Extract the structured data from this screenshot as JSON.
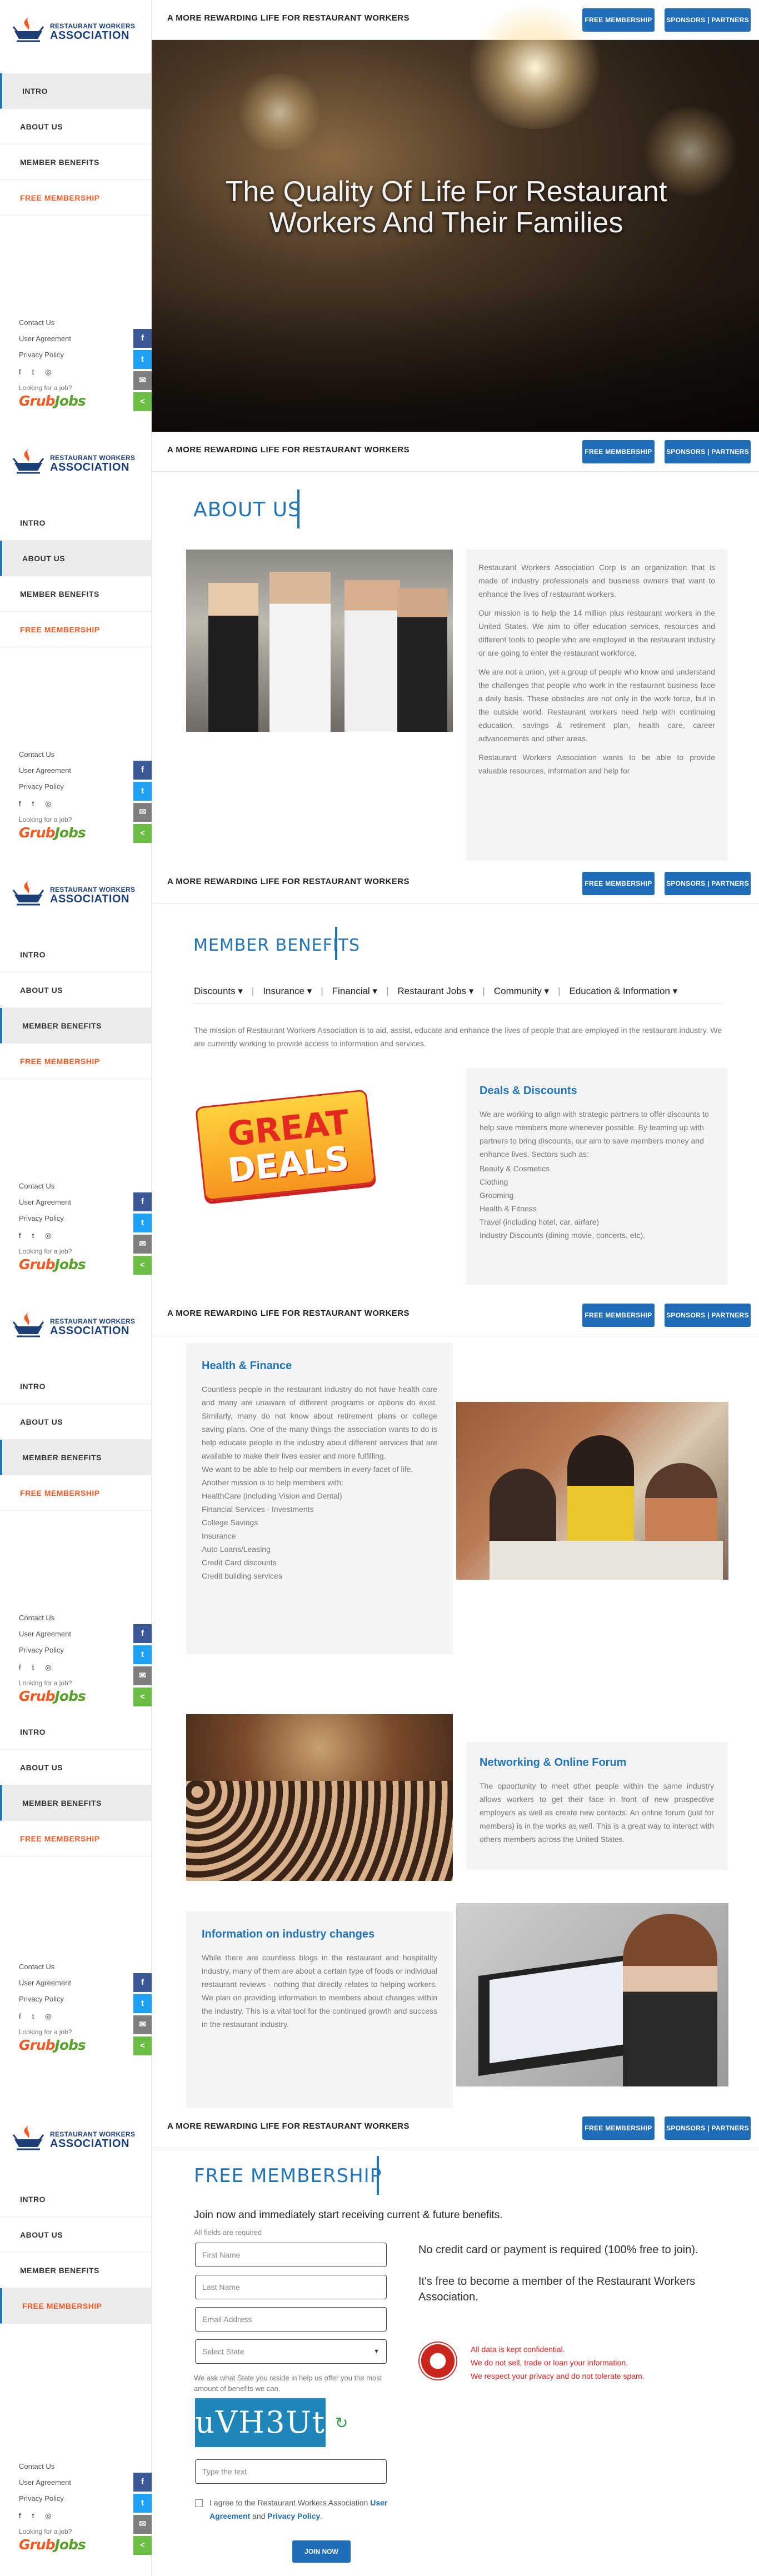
{
  "brand": {
    "line1": "RESTAURANT WORKERS",
    "line2": "ASSOCIATION"
  },
  "nav": [
    "INTRO",
    "ABOUT US",
    "MEMBER BENEFITS",
    "FREE MEMBERSHIP"
  ],
  "sidebar_footer": {
    "links": [
      "Contact Us",
      "User Agreement",
      "Privacy Policy"
    ],
    "looking": "Looking for a job?",
    "grub_a": "Grub",
    "grub_b": "Jobs"
  },
  "share_icons": [
    "f",
    "t",
    "✉",
    "<"
  ],
  "topbar": {
    "tagline": "A MORE REWARDING LIFE FOR RESTAURANT WORKERS",
    "btn_membership": "FREE MEMBERSHIP",
    "btn_sponsors": "SPONSORS | PARTNERS"
  },
  "intro": {
    "headline_1": "The Quality Of Life For Restaurant",
    "headline_2": "Workers And Their Families"
  },
  "about": {
    "title": "ABOUT US",
    "paras": [
      "Restaurant Workers Association Corp is an organization that is made of industry professionals and business owners that want to enhance the lives of restaurant workers.",
      "Our mission is to help the 14 million plus restaurant workers in the United States. We aim to offer education services, resources and different tools to people who are employed in the restaurant industry or are going to enter the restaurant workforce.",
      "We are not a union, yet a group of people who know and understand the challenges that people who work in the restaurant business face a daily basis. These obstacles are not only in the work force, but in the outside world. Restaurant workers need help with continuing education, savings & retirement plan, health care, career advancements and other areas.",
      "Restaurant Workers Association wants to be able to provide valuable resources, information and help for"
    ]
  },
  "benefits": {
    "title": "MEMBER BENEFITS",
    "subnav": [
      "Discounts ▾",
      "Insurance ▾",
      "Financial ▾",
      "Restaurant Jobs ▾",
      "Community ▾",
      "Education & Information ▾"
    ],
    "mission": "The mission of Restaurant Workers Association is to aid, assist, educate and enhance the lives of people that are employed in the restaurant industry. We are currently working to provide access to information and services.",
    "deals_img_1": "GREAT",
    "deals_img_2": "DEALS",
    "deals_title": "Deals & Discounts",
    "deals_text": "We are working to align with strategic partners to offer discounts to help save members more whenever possible. By teaming up with partners to bring discounts, our aim to save members money and enhance lives. Sectors such as:",
    "deals_list": [
      "Beauty & Cosmetics",
      "Clothing",
      "Grooming",
      "Health & Fitness",
      "Travel (including hotel, car, airfare)",
      "Industry Discounts (dining movie, concerts, etc)."
    ]
  },
  "health": {
    "title": "Health & Finance",
    "text": "Countless people in the restaurant industry do not have health care and many are unaware of different programs or options do exist. Similarly, many do not know about retirement plans or college saving plans. One of the many things the association wants to do is help educate people in the industry about different services that are available to make their lives easier and more fulfilling.",
    "text2": "We want to be able to help our members in every facet of life. Another mission is to help members with:",
    "list": [
      "HealthCare (including Vision and Dental)",
      "Financial Services - Investments",
      "College Savings",
      "Insurance",
      "Auto Loans/Leasing",
      "Credit Card discounts",
      "Credit building services"
    ]
  },
  "network": {
    "title": "Networking & Online Forum",
    "text": "The opportunity to meet other people within the same industry allows workers to get their face in front of new prospective employers as well as create new contacts. An online forum (just for members) is in the works as well. This is a great way to interact with others members across the United States."
  },
  "info": {
    "title": "Information on industry changes",
    "text": "While there are countless blogs in the restaurant and hospitality industry, many of them are about a certain type of foods or individual restaurant reviews - nothing that directly relates to helping workers. We plan on providing information to members about changes within the industry. This is a vital tool for the continued growth and success in the restaurant industry."
  },
  "membership": {
    "title": "FREE MEMBERSHIP",
    "lead": "Join now and immediately start receiving current & future benefits.",
    "required": "All fields are required",
    "placeholders": [
      "First Name",
      "Last Name",
      "Email Address"
    ],
    "select": "Select State",
    "state_note": "We ask what State you reside in help us offer you the most amount of benefits we can.",
    "captcha": "uVH3Ut",
    "captcha_input": "Type the text",
    "agree_a": "I agree to the Restaurant Workers Association ",
    "agree_b": "User Agreement",
    "agree_c": " and ",
    "agree_d": "Privacy Policy",
    "agree_e": ".",
    "join": "JOIN NOW",
    "no_card": "No credit card or payment is required (100% free to join).",
    "free_text": "It's free to become a member of the Restaurant Workers Association.",
    "privacy": [
      "All data is kept confidential.",
      "We do not sell, trade or loan your information.",
      "We respect your privacy and do not tolerate spam."
    ]
  },
  "colors": {
    "accent": "#2374b6",
    "orange": "#f15a24",
    "facebook": "#3b5998",
    "twitter": "#1da1f2",
    "email": "#7f7f7f",
    "share": "#6cbd45"
  }
}
